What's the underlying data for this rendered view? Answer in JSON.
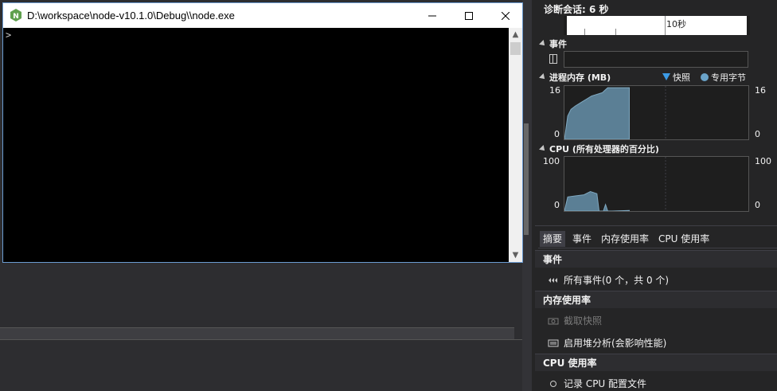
{
  "console": {
    "title": "D:\\workspace\\node-v10.1.0\\Debug\\\\node.exe",
    "prompt": ">"
  },
  "diag": {
    "session_label": "诊断会话: 6 秒",
    "timeline_tick_label": "10秒",
    "events_section": "事件",
    "memory": {
      "title": "进程内存 (MB)",
      "legend_snapshot": "快照",
      "legend_private": "专用字节",
      "y_max": "16",
      "y_min": "0"
    },
    "cpu": {
      "title": "CPU (所有处理器的百分比)",
      "y_max": "100",
      "y_min": "0"
    },
    "tabs": [
      "摘要",
      "事件",
      "内存使用率",
      "CPU 使用率"
    ],
    "list": {
      "events_head": "事件",
      "all_events": "所有事件(0 个，共 0 个)",
      "memory_head": "内存使用率",
      "take_snapshot": "截取快照",
      "heap_profiling": "启用堆分析(会影响性能)",
      "cpu_head": "CPU 使用率",
      "record_cpu": "记录 CPU 配置文件"
    },
    "colors": {
      "memory_fill": "#5b7f95",
      "snapshot_marker": "#3c9be6",
      "private_bytes": "#6aa3c9"
    }
  },
  "chart_data": [
    {
      "type": "area",
      "title": "进程内存 (MB)",
      "ylim": [
        0,
        16
      ],
      "x": [
        0,
        0.3,
        0.6,
        1.0,
        1.5,
        2.0,
        2.5,
        3.0,
        3.5,
        4.0,
        6.0
      ],
      "values": [
        0,
        7,
        9,
        10,
        11,
        12,
        13,
        13.5,
        14,
        15.5,
        15.5
      ],
      "xlim": [
        0,
        17
      ]
    },
    {
      "type": "area",
      "title": "CPU (所有处理器的百分比)",
      "ylim": [
        0,
        100
      ],
      "x": [
        0,
        0.3,
        1.0,
        1.8,
        2.4,
        3.0,
        3.2,
        3.6,
        3.8,
        4.0,
        4.4,
        6.0
      ],
      "values": [
        0,
        26,
        28,
        30,
        36,
        32,
        0,
        0,
        12,
        0,
        0,
        1
      ],
      "xlim": [
        0,
        17
      ]
    }
  ]
}
